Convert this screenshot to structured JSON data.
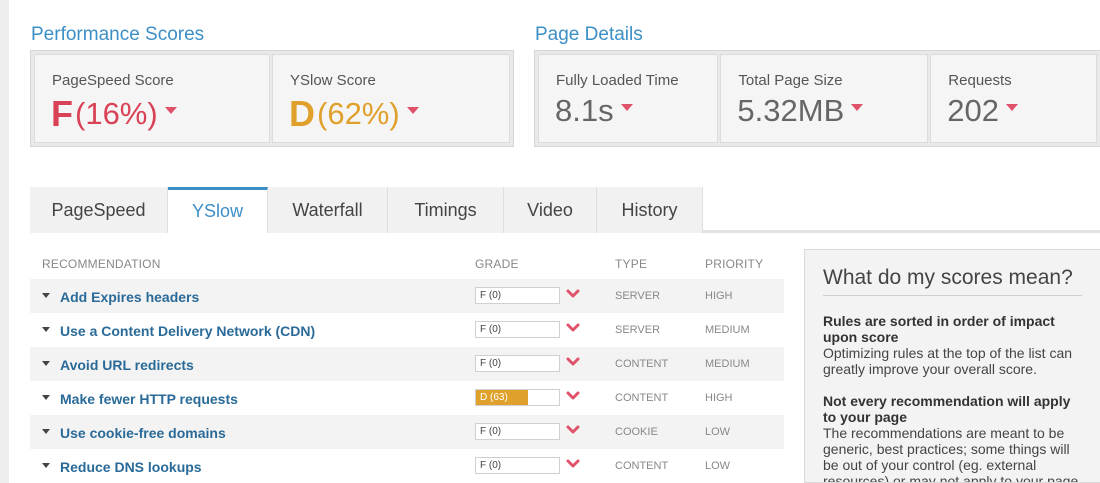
{
  "performance": {
    "title": "Performance Scores",
    "pagespeed": {
      "label": "PageSpeed Score",
      "grade": "F",
      "percent": "(16%)"
    },
    "yslow": {
      "label": "YSlow Score",
      "grade": "D",
      "percent": "(62%)"
    }
  },
  "details": {
    "title": "Page Details",
    "load_time": {
      "label": "Fully Loaded Time",
      "value": "8.1s"
    },
    "page_size": {
      "label": "Total Page Size",
      "value": "5.32MB"
    },
    "requests": {
      "label": "Requests",
      "value": "202"
    }
  },
  "tabs": [
    {
      "label": "PageSpeed"
    },
    {
      "label": "YSlow",
      "active": true
    },
    {
      "label": "Waterfall"
    },
    {
      "label": "Timings"
    },
    {
      "label": "Video"
    },
    {
      "label": "History"
    }
  ],
  "table": {
    "headers": {
      "recommendation": "RECOMMENDATION",
      "grade": "GRADE",
      "type": "TYPE",
      "priority": "PRIORITY"
    },
    "rows": [
      {
        "name": "Add Expires headers",
        "grade": "F (0)",
        "score_percent": 0,
        "type": "SERVER",
        "priority": "HIGH"
      },
      {
        "name": "Use a Content Delivery Network (CDN)",
        "grade": "F (0)",
        "score_percent": 0,
        "type": "SERVER",
        "priority": "MEDIUM"
      },
      {
        "name": "Avoid URL redirects",
        "grade": "F (0)",
        "score_percent": 0,
        "type": "CONTENT",
        "priority": "MEDIUM"
      },
      {
        "name": "Make fewer HTTP requests",
        "grade": "D (63)",
        "score_percent": 63,
        "type": "CONTENT",
        "priority": "HIGH"
      },
      {
        "name": "Use cookie-free domains",
        "grade": "F (0)",
        "score_percent": 0,
        "type": "COOKIE",
        "priority": "LOW"
      },
      {
        "name": "Reduce DNS lookups",
        "grade": "F (0)",
        "score_percent": 0,
        "type": "CONTENT",
        "priority": "LOW"
      }
    ]
  },
  "info": {
    "title": "What do my scores mean?",
    "sections": [
      {
        "heading": "Rules are sorted in order of impact upon score",
        "body": "Optimizing rules at the top of the list can greatly improve your overall score."
      },
      {
        "heading": "Not every recommendation will apply to your page",
        "body": "The recommendations are meant to be generic, best practices; some things will be out of your control (eg. external resources) or may not apply to your page"
      }
    ]
  },
  "colors": {
    "accent": "#3c8fc6",
    "grade_f": "#d94256",
    "grade_d": "#e0a02c",
    "link": "#2a6a98"
  }
}
